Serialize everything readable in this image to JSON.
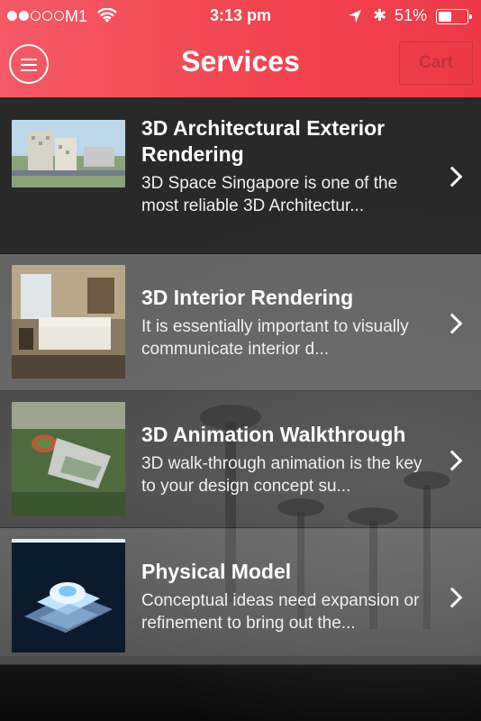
{
  "status_bar": {
    "carrier": "M1",
    "time": "3:13 pm",
    "battery": "51%",
    "battery_level": 0.51,
    "signal_bars_filled": 2,
    "signal_bars_total": 5
  },
  "header": {
    "title": "Services",
    "cart_label": "Cart",
    "menu_icon": "hamburger-menu-icon"
  },
  "services": [
    {
      "title": "3D Architectural Exterior Rendering",
      "description": "3D Space Singapore  is one of the most reliable 3D Architectur..."
    },
    {
      "title": "3D Interior Rendering",
      "description": "It is essentially important to visually communicate interior d..."
    },
    {
      "title": "3D Animation Walkthrough",
      "description": "3D walk-through animation is the key to your design concept su..."
    },
    {
      "title": "Physical Model",
      "description": "Conceptual ideas need expansion or refinement to bring out the..."
    }
  ],
  "colors": {
    "header_start": "#f55a66",
    "header_end": "#ee3a47",
    "cart_text": "#c0343f"
  }
}
